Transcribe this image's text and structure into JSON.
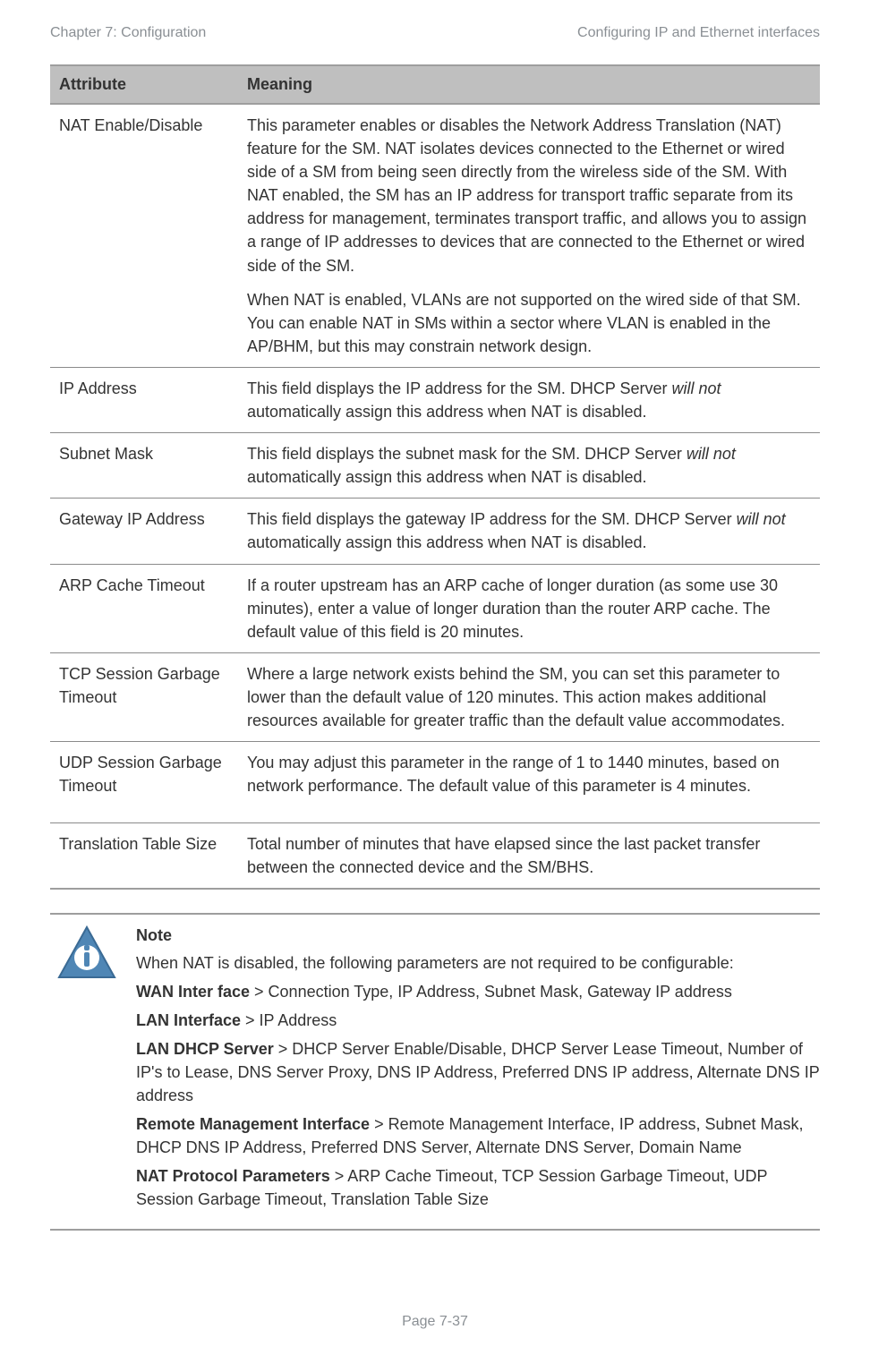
{
  "header": {
    "left": "Chapter 7:  Configuration",
    "right": "Configuring IP and Ethernet interfaces"
  },
  "table": {
    "head": {
      "attr": "Attribute",
      "mean": "Meaning"
    },
    "rows": [
      {
        "attr": "NAT Enable/Disable",
        "mean_parts": [
          {
            "t": "This parameter enables or disables the Network Address Translation (NAT) feature for the SM. NAT isolates devices connected to the Ethernet or wired side of a SM from being seen directly from the wireless side of the SM. With NAT enabled, the SM has an IP address for transport traffic separate from its address for management, terminates transport traffic, and allows you to assign a range of IP addresses to devices that are connected to the Ethernet or wired side of the SM."
          },
          {
            "t": "When NAT is enabled, VLANs are not supported on the wired side of that SM. You can enable NAT in SMs within a sector where VLAN is enabled in the AP/BHM, but this may constrain network design."
          }
        ]
      },
      {
        "attr": "IP Address",
        "mean_parts": [
          {
            "pre": "This field displays the IP address for the SM. DHCP Server ",
            "it": "will not",
            "post": " automatically assign this address when NAT is disabled."
          }
        ]
      },
      {
        "attr": "Subnet Mask",
        "mean_parts": [
          {
            "pre": "This field displays the subnet mask for the SM. DHCP Server ",
            "it": "will not",
            "post": " automatically assign this address when NAT is disabled."
          }
        ]
      },
      {
        "attr": "Gateway IP Address",
        "mean_parts": [
          {
            "pre": "This field displays the gateway IP address for the SM. DHCP Server ",
            "it": "will not",
            "post": " automatically assign this address when NAT is disabled."
          }
        ]
      },
      {
        "attr": "ARP Cache Timeout",
        "mean_parts": [
          {
            "t": "If a router upstream has an ARP cache of longer duration (as some use 30 minutes), enter a value of longer duration than the router ARP cache. The default value of this field is 20 minutes."
          }
        ]
      },
      {
        "attr": "TCP Session Garbage Timeout",
        "mean_parts": [
          {
            "t": "Where a large network exists behind the SM, you can set this parameter to lower than the default value of 120 minutes. This action makes additional resources available for greater traffic than the default value accommodates."
          }
        ]
      },
      {
        "attr": "UDP Session Garbage Timeout",
        "mean_parts": [
          {
            "t": "You may adjust this parameter in the range of 1 to 1440 minutes, based on network performance. The default value of this parameter is 4 minutes."
          }
        ],
        "extra_bottom_space": true
      },
      {
        "attr": "Translation Table Size",
        "mean_parts": [
          {
            "t": "Total number of minutes that have elapsed since the last packet transfer between the connected device and the SM/BHS."
          }
        ]
      }
    ]
  },
  "note": {
    "title": "Note",
    "intro": "When NAT is disabled, the following parameters are not required to be configurable:",
    "lines": [
      {
        "bold": "WAN Inter face",
        "rest": " > Connection Type, IP Address, Subnet Mask, Gateway IP address"
      },
      {
        "bold": "LAN Interface",
        "rest": " > IP Address"
      },
      {
        "bold": "LAN DHCP Server",
        "rest": " > DHCP Server Enable/Disable, DHCP Server Lease Timeout, Number of IP's to Lease, DNS Server Proxy, DNS IP Address, Preferred DNS IP address, Alternate DNS IP address"
      },
      {
        "bold": "Remote Management Interface",
        "rest": " > Remote Management Interface, IP address, Subnet Mask, DHCP DNS IP Address, Preferred DNS Server, Alternate DNS Server, Domain Name"
      },
      {
        "bold": "NAT Protocol Parameters",
        "rest": " > ARP Cache Timeout, TCP Session Garbage Timeout, UDP Session Garbage Timeout, Translation Table Size"
      }
    ]
  },
  "footer": "Page 7-37"
}
